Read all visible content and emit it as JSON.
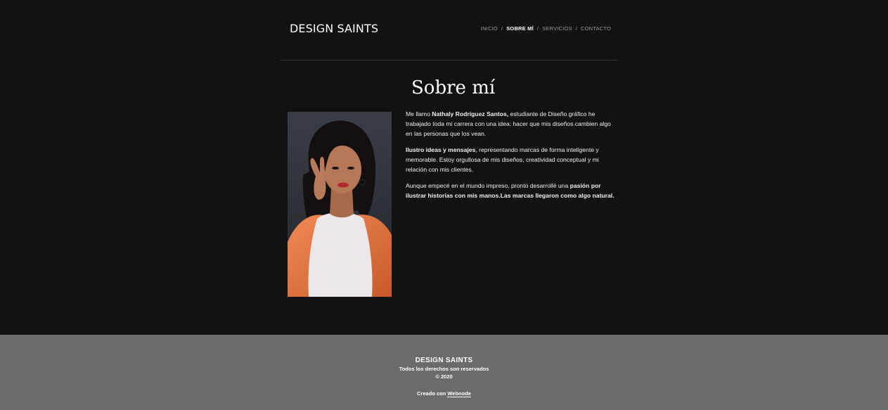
{
  "header": {
    "logo": "DESIGN SAINTS",
    "nav": [
      {
        "label": "INICIO",
        "active": false
      },
      {
        "label": "SOBRE MÍ",
        "active": true
      },
      {
        "label": "SERVICIOS",
        "active": false
      },
      {
        "label": "CONTACTO",
        "active": false
      }
    ],
    "separator": "/"
  },
  "main": {
    "title": "Sobre mí",
    "paragraphs": [
      {
        "p1": "Me llamo ",
        "b1": "Nathaly Rodríguez Santos,",
        "p2": " estudiante de Diseño gráfico  he trabajado toda mi carrera con una idea: hacer que mis diseños cambien algo en las personas que los vean."
      },
      {
        "b1": "Ilustro ideas y mensajes",
        "p2": ", representando marcas de forma inteligente y memorable. Estoy orgullosa de mis diseños, creatividad conceptual y mi relación con mis clientes."
      },
      {
        "p1": "Aunque empecé en el mundo impreso, pronto desarrollé una ",
        "b1": "pasión por ilustrar historias con mis manos.Las marcas llegaron como algo natural."
      }
    ]
  },
  "footer": {
    "brand": "DESIGN SAINTS",
    "rights": "Todos los derechos son reservados",
    "year": "© 2020",
    "created_prefix": "Creado con ",
    "created_link": "Webnode"
  },
  "colors": {
    "background": "#121212",
    "footer_bg": "#6b6b6d",
    "nav_inactive": "#9a9a9a",
    "jacket_orange": "#e0733f"
  }
}
